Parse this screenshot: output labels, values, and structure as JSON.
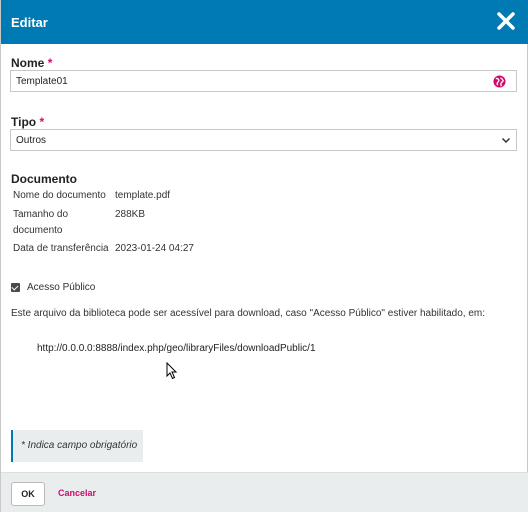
{
  "header": {
    "title": "Editar",
    "close_icon": "close-icon"
  },
  "form": {
    "nome": {
      "label": "Nome",
      "required_mark": "*",
      "value": "Template01",
      "icon": "globe-icon",
      "icon_color": "#d00a6c"
    },
    "tipo": {
      "label": "Tipo",
      "required_mark": "*",
      "selected": "Outros",
      "icon": "chevron-down-icon"
    },
    "documento": {
      "heading": "Documento",
      "rows": [
        {
          "key": "Nome do documento",
          "value": "template.pdf"
        },
        {
          "key": "Tamanho do documento",
          "value": "288KB"
        },
        {
          "key": "Data de transferência",
          "value": "2023-01-24 04:27"
        }
      ]
    },
    "acesso_publico": {
      "label": "Acesso Público",
      "checked": true
    },
    "info_text": "Este arquivo da biblioteca pode ser acessível para download, caso \"Acesso Público\" estiver habilitado, em:",
    "public_url": "http://0.0.0.0:8888/index.php/geo/libraryFiles/downloadPublic/1",
    "required_note": "* Indica campo obrigatório"
  },
  "footer": {
    "ok_label": "OK",
    "cancel_label": "Cancelar"
  },
  "colors": {
    "header_bg": "#007ab2",
    "accent": "#d00a6c",
    "footer_bg": "#eaedee"
  }
}
